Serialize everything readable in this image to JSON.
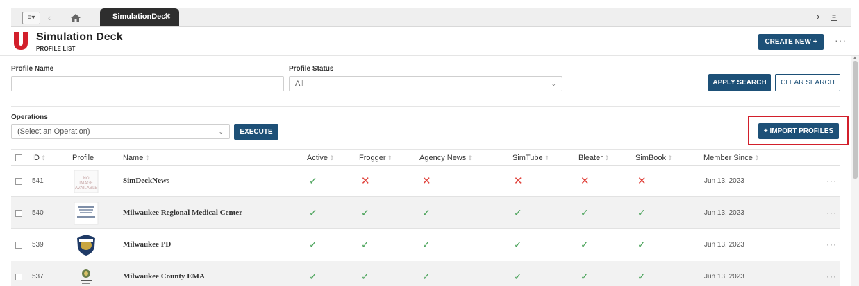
{
  "tabs": {
    "menu_icon": "menu-icon",
    "active_tab_label": "SimulationDeck",
    "close_glyph": "✖"
  },
  "header": {
    "title": "Simulation Deck",
    "subtitle": "PROFILE LIST",
    "create_button": "CREATE NEW  +",
    "more_glyph": "···"
  },
  "search": {
    "profile_name_label": "Profile Name",
    "profile_name_value": "",
    "profile_status_label": "Profile Status",
    "profile_status_value": "All",
    "apply_button": "APPLY SEARCH",
    "clear_button": "CLEAR SEARCH"
  },
  "operations": {
    "label": "Operations",
    "select_value": "(Select an Operation)",
    "execute_button": "EXECUTE",
    "import_button": "+ IMPORT PROFILES"
  },
  "table": {
    "columns": [
      "ID",
      "Profile",
      "Name",
      "Active",
      "Frogger",
      "Agency News",
      "SimTube",
      "Bleater",
      "SimBook",
      "Member Since"
    ],
    "rows": [
      {
        "id": "541",
        "name": "SimDeckNews",
        "flags": [
          true,
          false,
          false,
          false,
          false,
          false
        ],
        "member_since": "Jun 13, 2023"
      },
      {
        "id": "540",
        "name": "Milwaukee Regional Medical Center",
        "flags": [
          true,
          true,
          true,
          true,
          true,
          true
        ],
        "member_since": "Jun 13, 2023"
      },
      {
        "id": "539",
        "name": "Milwaukee PD",
        "flags": [
          true,
          true,
          true,
          true,
          true,
          true
        ],
        "member_since": "Jun 13, 2023"
      },
      {
        "id": "537",
        "name": "Milwaukee County EMA",
        "flags": [
          true,
          true,
          true,
          true,
          true,
          true
        ],
        "member_since": "Jun 13, 2023"
      }
    ],
    "check_glyph": "✓",
    "cross_glyph": "✕",
    "row_more_glyph": "···"
  },
  "colors": {
    "primary": "#1d5077",
    "highlight": "#d21f2b",
    "check": "#4aa35a",
    "cross": "#e0413a",
    "tab_active": "#2e2e2e"
  }
}
